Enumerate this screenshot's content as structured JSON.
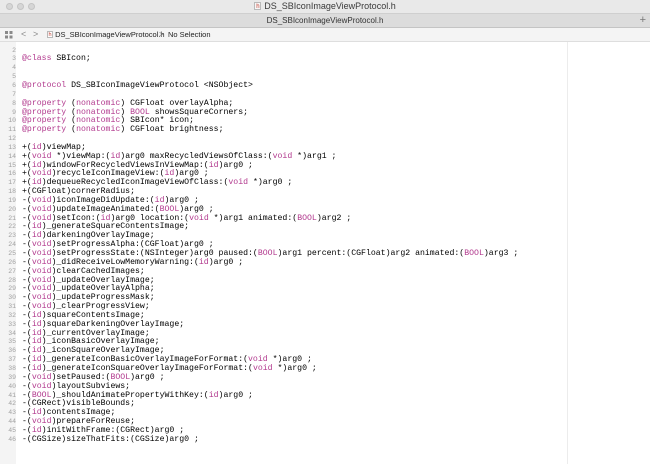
{
  "window": {
    "title": "DS_SBIconImageViewProtocol.h"
  },
  "tab": {
    "label": "DS_SBIconImageViewProtocol.h",
    "add_symbol": "+"
  },
  "jumpbar": {
    "back": "<",
    "forward": ">",
    "file": "DS_SBIconImageViewProtocol.h",
    "separator": ">",
    "selection": "No Selection"
  },
  "colors": {
    "keyword": "#b23a8e",
    "line_number": "#a0a0a0"
  },
  "code": {
    "lines": [
      {
        "n": "2",
        "segs": []
      },
      {
        "n": "3",
        "segs": [
          {
            "k": 1,
            "t": "@class"
          },
          {
            "k": 0,
            "t": " SBIcon;"
          }
        ]
      },
      {
        "n": "4",
        "segs": []
      },
      {
        "n": "5",
        "segs": []
      },
      {
        "n": "6",
        "segs": [
          {
            "k": 1,
            "t": "@protocol"
          },
          {
            "k": 0,
            "t": " DS_SBIconImageViewProtocol <NSObject>"
          }
        ]
      },
      {
        "n": "7",
        "segs": []
      },
      {
        "n": "8",
        "segs": [
          {
            "k": 1,
            "t": "@property"
          },
          {
            "k": 0,
            "t": " ("
          },
          {
            "k": 1,
            "t": "nonatomic"
          },
          {
            "k": 0,
            "t": ") CGFloat overlayAlpha;"
          }
        ]
      },
      {
        "n": "9",
        "segs": [
          {
            "k": 1,
            "t": "@property"
          },
          {
            "k": 0,
            "t": " ("
          },
          {
            "k": 1,
            "t": "nonatomic"
          },
          {
            "k": 0,
            "t": ") "
          },
          {
            "k": 1,
            "t": "BOOL"
          },
          {
            "k": 0,
            "t": " showsSquareCorners;"
          }
        ]
      },
      {
        "n": "10",
        "segs": [
          {
            "k": 1,
            "t": "@property"
          },
          {
            "k": 0,
            "t": " ("
          },
          {
            "k": 1,
            "t": "nonatomic"
          },
          {
            "k": 0,
            "t": ") SBIcon* icon;"
          }
        ]
      },
      {
        "n": "11",
        "segs": [
          {
            "k": 1,
            "t": "@property"
          },
          {
            "k": 0,
            "t": " ("
          },
          {
            "k": 1,
            "t": "nonatomic"
          },
          {
            "k": 0,
            "t": ") CGFloat brightness;"
          }
        ]
      },
      {
        "n": "12",
        "segs": []
      },
      {
        "n": "13",
        "segs": [
          {
            "k": 0,
            "t": "+("
          },
          {
            "k": 1,
            "t": "id"
          },
          {
            "k": 0,
            "t": ")viewMap;"
          }
        ]
      },
      {
        "n": "14",
        "segs": [
          {
            "k": 0,
            "t": "+("
          },
          {
            "k": 1,
            "t": "void"
          },
          {
            "k": 0,
            "t": " *)viewMap:("
          },
          {
            "k": 1,
            "t": "id"
          },
          {
            "k": 0,
            "t": ")arg0 maxRecycledViewsOfClass:("
          },
          {
            "k": 1,
            "t": "void"
          },
          {
            "k": 0,
            "t": " *)arg1 ;"
          }
        ]
      },
      {
        "n": "15",
        "segs": [
          {
            "k": 0,
            "t": "+("
          },
          {
            "k": 1,
            "t": "id"
          },
          {
            "k": 0,
            "t": ")windowForRecycledViewsInViewMap:("
          },
          {
            "k": 1,
            "t": "id"
          },
          {
            "k": 0,
            "t": ")arg0 ;"
          }
        ]
      },
      {
        "n": "16",
        "segs": [
          {
            "k": 0,
            "t": "+("
          },
          {
            "k": 1,
            "t": "void"
          },
          {
            "k": 0,
            "t": ")recycleIconImageView:("
          },
          {
            "k": 1,
            "t": "id"
          },
          {
            "k": 0,
            "t": ")arg0 ;"
          }
        ]
      },
      {
        "n": "17",
        "segs": [
          {
            "k": 0,
            "t": "+("
          },
          {
            "k": 1,
            "t": "id"
          },
          {
            "k": 0,
            "t": ")dequeueRecycledIconImageViewOfClass:("
          },
          {
            "k": 1,
            "t": "void"
          },
          {
            "k": 0,
            "t": " *)arg0 ;"
          }
        ]
      },
      {
        "n": "18",
        "segs": [
          {
            "k": 0,
            "t": "+(CGFloat)cornerRadius;"
          }
        ]
      },
      {
        "n": "19",
        "segs": [
          {
            "k": 0,
            "t": "-("
          },
          {
            "k": 1,
            "t": "void"
          },
          {
            "k": 0,
            "t": ")iconImageDidUpdate:("
          },
          {
            "k": 1,
            "t": "id"
          },
          {
            "k": 0,
            "t": ")arg0 ;"
          }
        ]
      },
      {
        "n": "20",
        "segs": [
          {
            "k": 0,
            "t": "-("
          },
          {
            "k": 1,
            "t": "void"
          },
          {
            "k": 0,
            "t": ")updateImageAnimated:("
          },
          {
            "k": 1,
            "t": "BOOL"
          },
          {
            "k": 0,
            "t": ")arg0 ;"
          }
        ]
      },
      {
        "n": "21",
        "segs": [
          {
            "k": 0,
            "t": "-("
          },
          {
            "k": 1,
            "t": "void"
          },
          {
            "k": 0,
            "t": ")setIcon:("
          },
          {
            "k": 1,
            "t": "id"
          },
          {
            "k": 0,
            "t": ")arg0 location:("
          },
          {
            "k": 1,
            "t": "void"
          },
          {
            "k": 0,
            "t": " *)arg1 animated:("
          },
          {
            "k": 1,
            "t": "BOOL"
          },
          {
            "k": 0,
            "t": ")arg2 ;"
          }
        ]
      },
      {
        "n": "22",
        "segs": [
          {
            "k": 0,
            "t": "-("
          },
          {
            "k": 1,
            "t": "id"
          },
          {
            "k": 0,
            "t": ")_generateSquareContentsImage;"
          }
        ]
      },
      {
        "n": "23",
        "segs": [
          {
            "k": 0,
            "t": "-("
          },
          {
            "k": 1,
            "t": "id"
          },
          {
            "k": 0,
            "t": ")darkeningOverlayImage;"
          }
        ]
      },
      {
        "n": "24",
        "segs": [
          {
            "k": 0,
            "t": "-("
          },
          {
            "k": 1,
            "t": "void"
          },
          {
            "k": 0,
            "t": ")setProgressAlpha:(CGFloat)arg0 ;"
          }
        ]
      },
      {
        "n": "25",
        "segs": [
          {
            "k": 0,
            "t": "-("
          },
          {
            "k": 1,
            "t": "void"
          },
          {
            "k": 0,
            "t": ")setProgressState:(NSInteger)arg0 paused:("
          },
          {
            "k": 1,
            "t": "BOOL"
          },
          {
            "k": 0,
            "t": ")arg1 percent:(CGFloat)arg2 animated:("
          },
          {
            "k": 1,
            "t": "BOOL"
          },
          {
            "k": 0,
            "t": ")arg3 ;"
          }
        ]
      },
      {
        "n": "26",
        "segs": [
          {
            "k": 0,
            "t": "-("
          },
          {
            "k": 1,
            "t": "void"
          },
          {
            "k": 0,
            "t": ")_didReceiveLowMemoryWarning:("
          },
          {
            "k": 1,
            "t": "id"
          },
          {
            "k": 0,
            "t": ")arg0 ;"
          }
        ]
      },
      {
        "n": "27",
        "segs": [
          {
            "k": 0,
            "t": "-("
          },
          {
            "k": 1,
            "t": "void"
          },
          {
            "k": 0,
            "t": ")clearCachedImages;"
          }
        ]
      },
      {
        "n": "28",
        "segs": [
          {
            "k": 0,
            "t": "-("
          },
          {
            "k": 1,
            "t": "void"
          },
          {
            "k": 0,
            "t": ")_updateOverlayImage;"
          }
        ]
      },
      {
        "n": "29",
        "segs": [
          {
            "k": 0,
            "t": "-("
          },
          {
            "k": 1,
            "t": "void"
          },
          {
            "k": 0,
            "t": ")_updateOverlayAlpha;"
          }
        ]
      },
      {
        "n": "30",
        "segs": [
          {
            "k": 0,
            "t": "-("
          },
          {
            "k": 1,
            "t": "void"
          },
          {
            "k": 0,
            "t": ")_updateProgressMask;"
          }
        ]
      },
      {
        "n": "31",
        "segs": [
          {
            "k": 0,
            "t": "-("
          },
          {
            "k": 1,
            "t": "void"
          },
          {
            "k": 0,
            "t": ")_clearProgressView;"
          }
        ]
      },
      {
        "n": "32",
        "segs": [
          {
            "k": 0,
            "t": "-("
          },
          {
            "k": 1,
            "t": "id"
          },
          {
            "k": 0,
            "t": ")squareContentsImage;"
          }
        ]
      },
      {
        "n": "33",
        "segs": [
          {
            "k": 0,
            "t": "-("
          },
          {
            "k": 1,
            "t": "id"
          },
          {
            "k": 0,
            "t": ")squareDarkeningOverlayImage;"
          }
        ]
      },
      {
        "n": "34",
        "segs": [
          {
            "k": 0,
            "t": "-("
          },
          {
            "k": 1,
            "t": "id"
          },
          {
            "k": 0,
            "t": ")_currentOverlayImage;"
          }
        ]
      },
      {
        "n": "35",
        "segs": [
          {
            "k": 0,
            "t": "-("
          },
          {
            "k": 1,
            "t": "id"
          },
          {
            "k": 0,
            "t": ")_iconBasicOverlayImage;"
          }
        ]
      },
      {
        "n": "36",
        "segs": [
          {
            "k": 0,
            "t": "-("
          },
          {
            "k": 1,
            "t": "id"
          },
          {
            "k": 0,
            "t": ")_iconSquareOverlayImage;"
          }
        ]
      },
      {
        "n": "37",
        "segs": [
          {
            "k": 0,
            "t": "-("
          },
          {
            "k": 1,
            "t": "id"
          },
          {
            "k": 0,
            "t": ")_generateIconBasicOverlayImageForFormat:("
          },
          {
            "k": 1,
            "t": "void"
          },
          {
            "k": 0,
            "t": " *)arg0 ;"
          }
        ]
      },
      {
        "n": "38",
        "segs": [
          {
            "k": 0,
            "t": "-("
          },
          {
            "k": 1,
            "t": "id"
          },
          {
            "k": 0,
            "t": ")_generateIconSquareOverlayImageForFormat:("
          },
          {
            "k": 1,
            "t": "void"
          },
          {
            "k": 0,
            "t": " *)arg0 ;"
          }
        ]
      },
      {
        "n": "39",
        "segs": [
          {
            "k": 0,
            "t": "-("
          },
          {
            "k": 1,
            "t": "void"
          },
          {
            "k": 0,
            "t": ")setPaused:("
          },
          {
            "k": 1,
            "t": "BOOL"
          },
          {
            "k": 0,
            "t": ")arg0 ;"
          }
        ]
      },
      {
        "n": "40",
        "segs": [
          {
            "k": 0,
            "t": "-("
          },
          {
            "k": 1,
            "t": "void"
          },
          {
            "k": 0,
            "t": ")layoutSubviews;"
          }
        ]
      },
      {
        "n": "41",
        "segs": [
          {
            "k": 0,
            "t": "-("
          },
          {
            "k": 1,
            "t": "BOOL"
          },
          {
            "k": 0,
            "t": ")_shouldAnimatePropertyWithKey:("
          },
          {
            "k": 1,
            "t": "id"
          },
          {
            "k": 0,
            "t": ")arg0 ;"
          }
        ]
      },
      {
        "n": "42",
        "segs": [
          {
            "k": 0,
            "t": "-(CGRect)visibleBounds;"
          }
        ]
      },
      {
        "n": "43",
        "segs": [
          {
            "k": 0,
            "t": "-("
          },
          {
            "k": 1,
            "t": "id"
          },
          {
            "k": 0,
            "t": ")contentsImage;"
          }
        ]
      },
      {
        "n": "44",
        "segs": [
          {
            "k": 0,
            "t": "-("
          },
          {
            "k": 1,
            "t": "void"
          },
          {
            "k": 0,
            "t": ")prepareForReuse;"
          }
        ]
      },
      {
        "n": "45",
        "segs": [
          {
            "k": 0,
            "t": "-("
          },
          {
            "k": 1,
            "t": "id"
          },
          {
            "k": 0,
            "t": ")initWithFrame:(CGRect)arg0 ;"
          }
        ]
      },
      {
        "n": "46",
        "segs": [
          {
            "k": 0,
            "t": "-(CGSize)sizeThatFits:(CGSize)arg0 ;"
          }
        ]
      }
    ]
  }
}
